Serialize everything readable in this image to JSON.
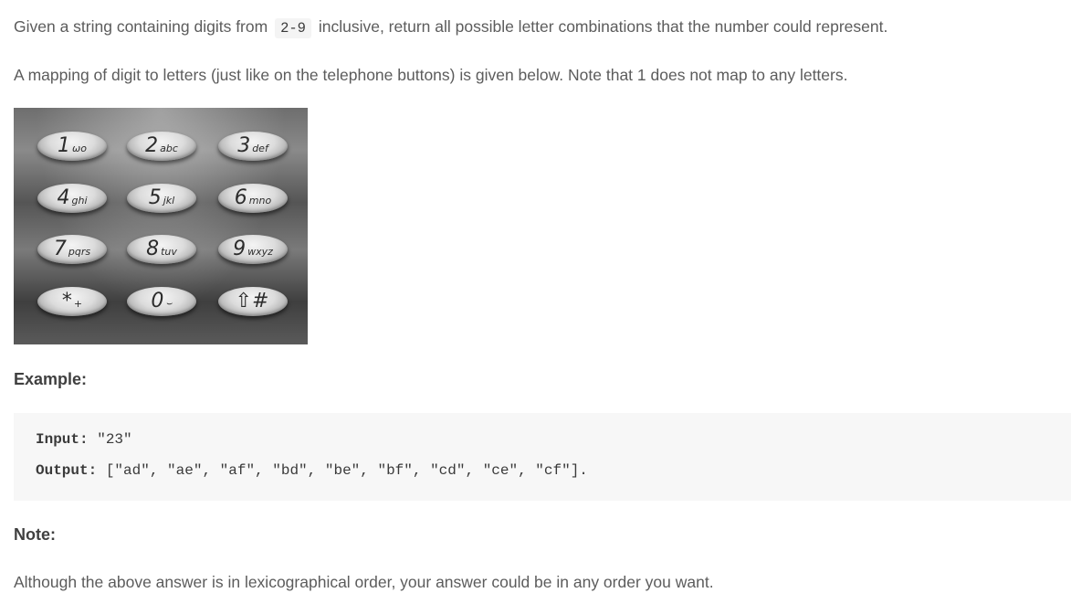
{
  "intro": {
    "before_code": "Given a string containing digits from ",
    "code": "2-9",
    "after_code": " inclusive, return all possible letter combinations that the number could represent."
  },
  "mapping_text": "A mapping of digit to letters (just like on the telephone buttons) is given below. Note that 1 does not map to any letters.",
  "keypad": {
    "keys": [
      {
        "digit": "1",
        "letters": "ωο"
      },
      {
        "digit": "2",
        "letters": "abc"
      },
      {
        "digit": "3",
        "letters": "def"
      },
      {
        "digit": "4",
        "letters": "ghi"
      },
      {
        "digit": "5",
        "letters": "jkl"
      },
      {
        "digit": "6",
        "letters": "mno"
      },
      {
        "digit": "7",
        "letters": "pqrs"
      },
      {
        "digit": "8",
        "letters": "tuv"
      },
      {
        "digit": "9",
        "letters": "wxyz"
      },
      {
        "digit": "*",
        "letters": "+"
      },
      {
        "digit": "0",
        "letters": "⌣"
      },
      {
        "digit": "⇧#",
        "letters": ""
      }
    ]
  },
  "example": {
    "heading": "Example:",
    "input_label": "Input:",
    "input_value": " \"23\"",
    "output_label": "Output:",
    "output_value": " [\"ad\", \"ae\", \"af\", \"bd\", \"be\", \"bf\", \"cd\", \"ce\", \"cf\"]."
  },
  "note": {
    "heading": "Note:",
    "text": "Although the above answer is in lexicographical order, your answer could be in any order you want."
  }
}
